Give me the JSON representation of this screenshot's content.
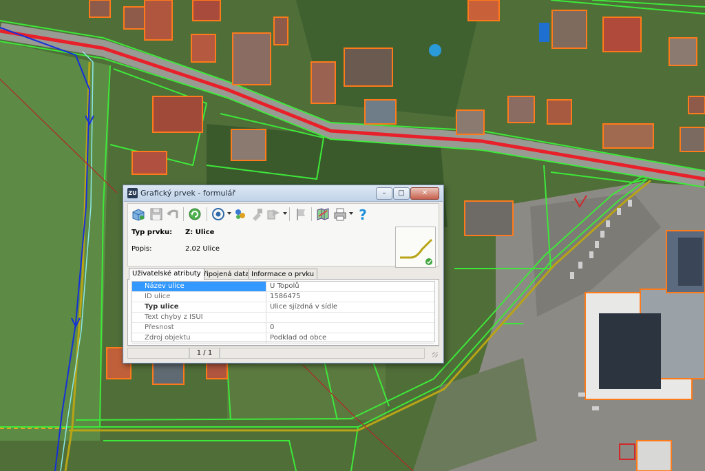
{
  "window": {
    "title": "Grafický prvek - formulář",
    "app_icon": "ZU"
  },
  "toolbar": {
    "buttons": [
      "open-icon",
      "save-icon",
      "undo-icon",
      "refresh-icon",
      "locate-icon",
      "layers-icon",
      "tool-icon",
      "copy-icon",
      "flag-icon",
      "map-icon",
      "print-icon",
      "help-icon"
    ]
  },
  "feature": {
    "type_label": "Typ prvku:",
    "type_value": "Z: Ulice",
    "desc_label": "Popis:",
    "desc_value": "2.02 Ulice"
  },
  "tabs": [
    "Uživatelské atributy",
    "Připojená data",
    "Informace o prvku"
  ],
  "attributes": [
    {
      "key": "Název ulice",
      "value": "U Topolů"
    },
    {
      "key": "ID ulice",
      "value": "1586475"
    },
    {
      "key": "Typ ulice",
      "value": "Ulice sjízdná v sídle"
    },
    {
      "key": "Text chyby z ISUI",
      "value": ""
    },
    {
      "key": "Přesnost",
      "value": "0"
    },
    {
      "key": "Zdroj objektu",
      "value": "Podklad od obce"
    }
  ],
  "status": {
    "pager": "1 / 1"
  },
  "colors": {
    "road_highlight": "#e8202a",
    "parcel_outline": "#3ee83a",
    "building_outline": "#ff7a1a",
    "stream": "#1530d8",
    "selected_line": "#b8a416"
  }
}
